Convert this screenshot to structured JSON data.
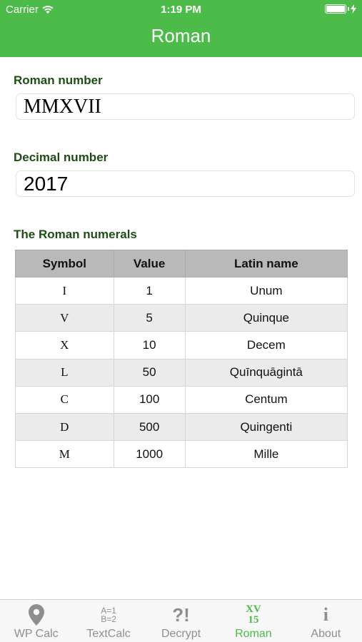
{
  "status_bar": {
    "carrier": "Carrier",
    "time": "1:19 PM"
  },
  "header": {
    "title": "Roman"
  },
  "roman_section": {
    "label": "Roman number",
    "value": "MMXVII"
  },
  "decimal_section": {
    "label": "Decimal number",
    "value": "2017"
  },
  "numerals_section": {
    "label": "The Roman numerals",
    "columns": [
      "Symbol",
      "Value",
      "Latin name"
    ],
    "rows": [
      {
        "symbol": "I",
        "value": "1",
        "latin": "Unum"
      },
      {
        "symbol": "V",
        "value": "5",
        "latin": "Quinque"
      },
      {
        "symbol": "X",
        "value": "10",
        "latin": "Decem"
      },
      {
        "symbol": "L",
        "value": "50",
        "latin": "Quīnquāgintā"
      },
      {
        "symbol": "C",
        "value": "100",
        "latin": "Centum"
      },
      {
        "symbol": "D",
        "value": "500",
        "latin": "Quingenti"
      },
      {
        "symbol": "M",
        "value": "1000",
        "latin": "Mille"
      }
    ]
  },
  "tabs": [
    {
      "label": "WP Calc",
      "icon": "location-pin-icon"
    },
    {
      "label": "TextCalc",
      "icon": "equations-icon",
      "glyph_top": "A=1",
      "glyph_bottom": "B=2"
    },
    {
      "label": "Decrypt",
      "icon": "question-exclamation-icon",
      "glyph": "?!"
    },
    {
      "label": "Roman",
      "icon": "roman-numeral-icon",
      "glyph_top": "XV",
      "glyph_bottom": "15",
      "active": true
    },
    {
      "label": "About",
      "icon": "info-icon",
      "glyph": "i"
    }
  ],
  "colors": {
    "accent": "#4cbb4a",
    "label": "#1e4d16",
    "table_header": "#b9b9b9",
    "alt_row": "#ebebeb",
    "inactive_tab": "#8e8e8e"
  }
}
